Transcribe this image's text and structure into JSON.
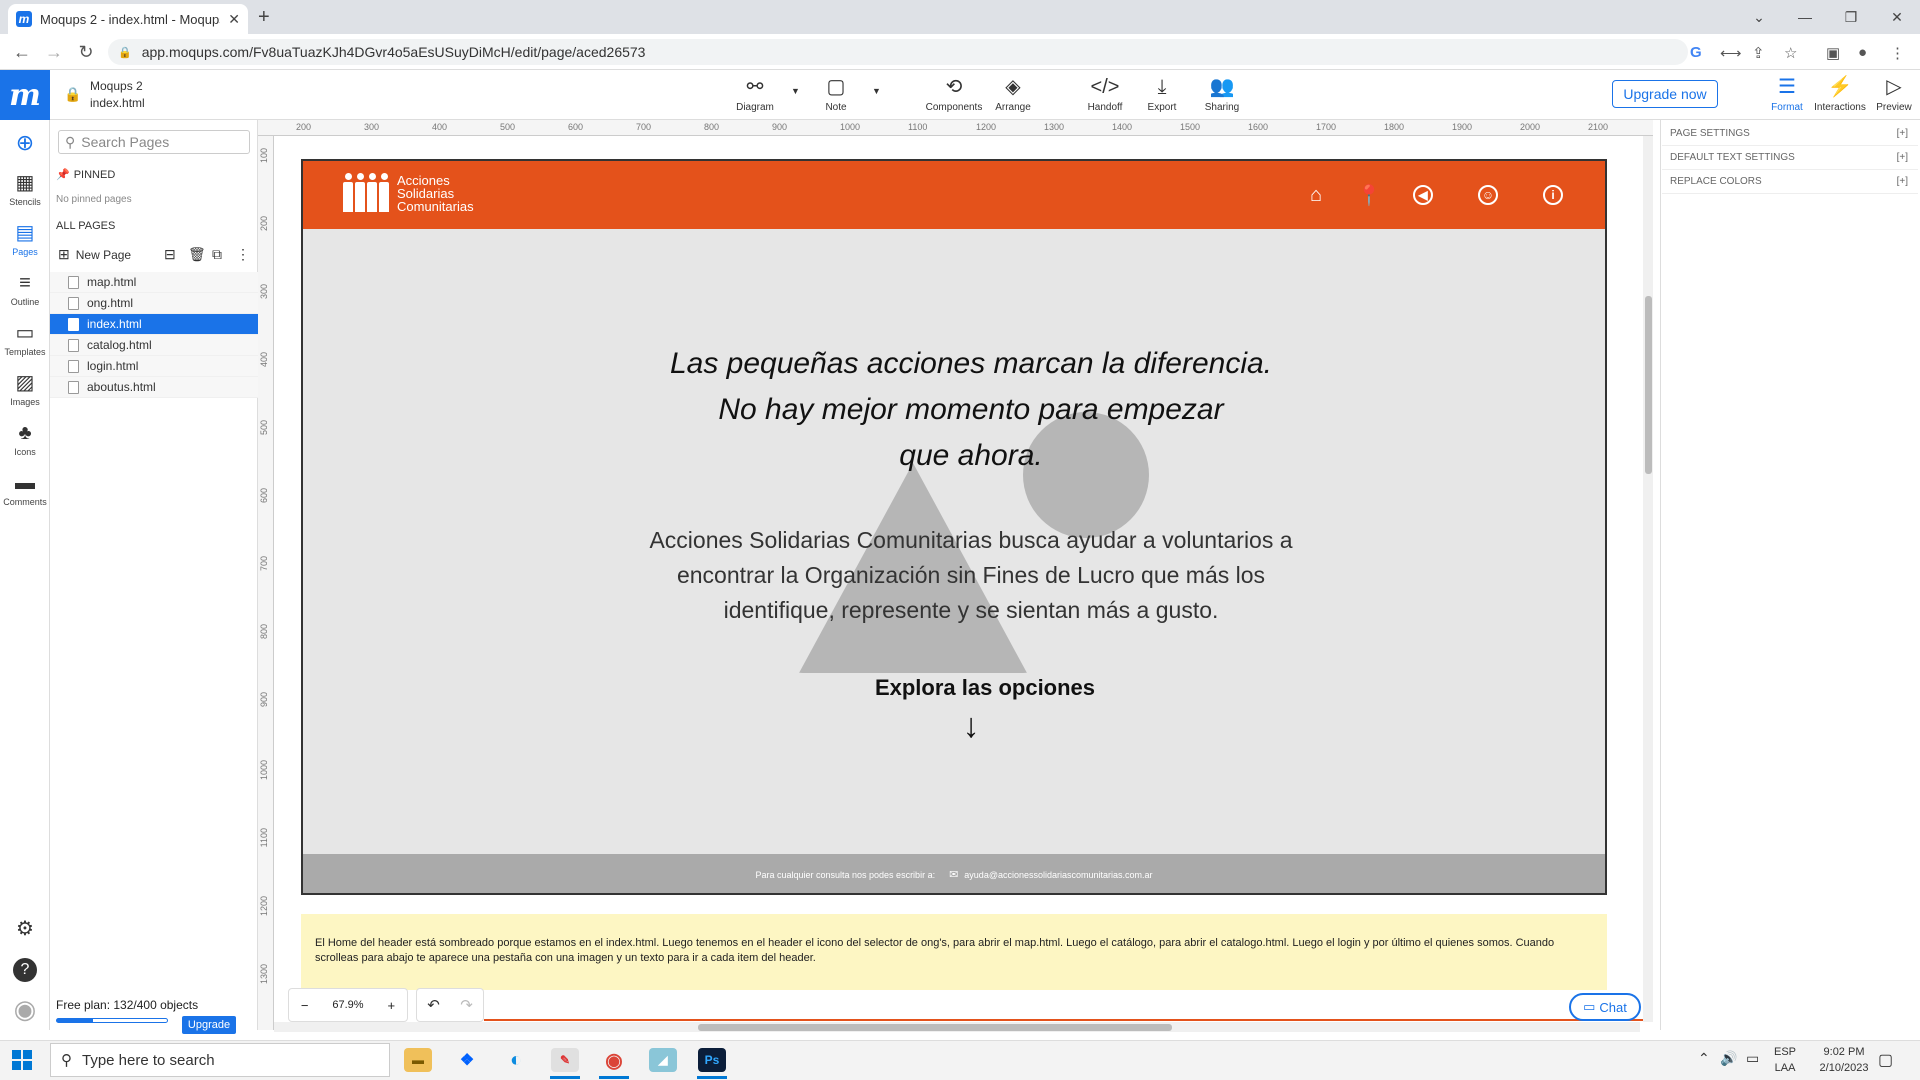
{
  "browser": {
    "tab_title": "Moqups 2 - index.html - Moqups",
    "tab_close": "✕",
    "new_tab": "+",
    "url": "app.moqups.com/Fv8uaTuazKJh4DGvr4o5aEsUSuyDiMcH/edit/page/aced26573"
  },
  "header": {
    "project_name": "Moqups 2",
    "page_name": "index.html",
    "tools": [
      {
        "label": "Diagram"
      },
      {
        "label": "Note"
      },
      {
        "label": "Components"
      },
      {
        "label": "Arrange"
      },
      {
        "label": "Handoff"
      },
      {
        "label": "Export"
      },
      {
        "label": "Sharing"
      }
    ],
    "upgrade_label": "Upgrade now",
    "right_tools": [
      {
        "label": "Format"
      },
      {
        "label": "Interactions"
      },
      {
        "label": "Preview"
      }
    ]
  },
  "rail": {
    "items": [
      {
        "label": "Stencils"
      },
      {
        "label": "Pages"
      },
      {
        "label": "Outline"
      },
      {
        "label": "Templates"
      },
      {
        "label": "Images"
      },
      {
        "label": "Icons"
      },
      {
        "label": "Comments"
      }
    ]
  },
  "pages_panel": {
    "search_placeholder": "Search Pages",
    "pinned_label": "PINNED",
    "no_pinned": "No pinned pages",
    "all_pages_label": "ALL PAGES",
    "new_page_label": "New Page",
    "pages": [
      "map.html",
      "ong.html",
      "index.html",
      "catalog.html",
      "login.html",
      "aboutus.html"
    ],
    "selected_page": "index.html",
    "plan_text": "Free plan: 132/400 objects",
    "plan_usage": 0.33,
    "plan_upgrade": "Upgrade"
  },
  "rulers": {
    "h_ticks": [
      "200",
      "300",
      "400",
      "500",
      "600",
      "700",
      "800",
      "900",
      "1000",
      "1100",
      "1200",
      "1300",
      "1400",
      "1500",
      "1600",
      "1700",
      "1800",
      "1900",
      "2000",
      "2100"
    ],
    "v_ticks": [
      "100",
      "200",
      "300",
      "400",
      "500",
      "600",
      "700",
      "800",
      "900",
      "1000",
      "1100",
      "1200",
      "1300"
    ]
  },
  "mockup": {
    "logo_text_1": "Acciones",
    "logo_text_2": "Solidarias",
    "logo_text_3": "Comunitarias",
    "headline_1": "Las pequeñas acciones marcan la diferencia.",
    "headline_2": "No hay mejor momento para empezar",
    "headline_3": "que ahora.",
    "desc_1": "Acciones Solidarias Comunitarias busca ayudar a voluntarios a",
    "desc_2": "encontrar la Organización sin Fines de Lucro que más los",
    "desc_3": "identifique, represente y se sientan más a gusto.",
    "explore": "Explora las opciones",
    "arrow": "↓",
    "footer_text": "Para cualquier consulta nos podes escribir a:",
    "footer_email": "ayuda@accionessolidariascomunitarias.com.ar",
    "header_color": "#e4521b"
  },
  "note": {
    "text": "El Home del header está sombreado porque estamos en el index.html. Luego tenemos en el header el icono del selector de ong's, para abrir el map.html. Luego el catálogo, para abrir el catalogo.html. Luego el login y por último el quienes somos. Cuando scrolleas para abajo te aparece una pestaña con una imagen y un texto para ir a cada item del header."
  },
  "zoom": {
    "minus": "−",
    "value": "67.9%",
    "plus": "+"
  },
  "chat_label": "Chat",
  "right_panel": {
    "rows": [
      {
        "label": "PAGE SETTINGS",
        "toggle": "[+]"
      },
      {
        "label": "DEFAULT TEXT SETTINGS",
        "toggle": "[+]"
      },
      {
        "label": "REPLACE COLORS",
        "toggle": "[+]"
      }
    ]
  },
  "taskbar": {
    "search_placeholder": "Type here to search",
    "lang_1": "ESP",
    "lang_2": "LAA",
    "time": "9:02 PM",
    "date": "2/10/2023"
  }
}
